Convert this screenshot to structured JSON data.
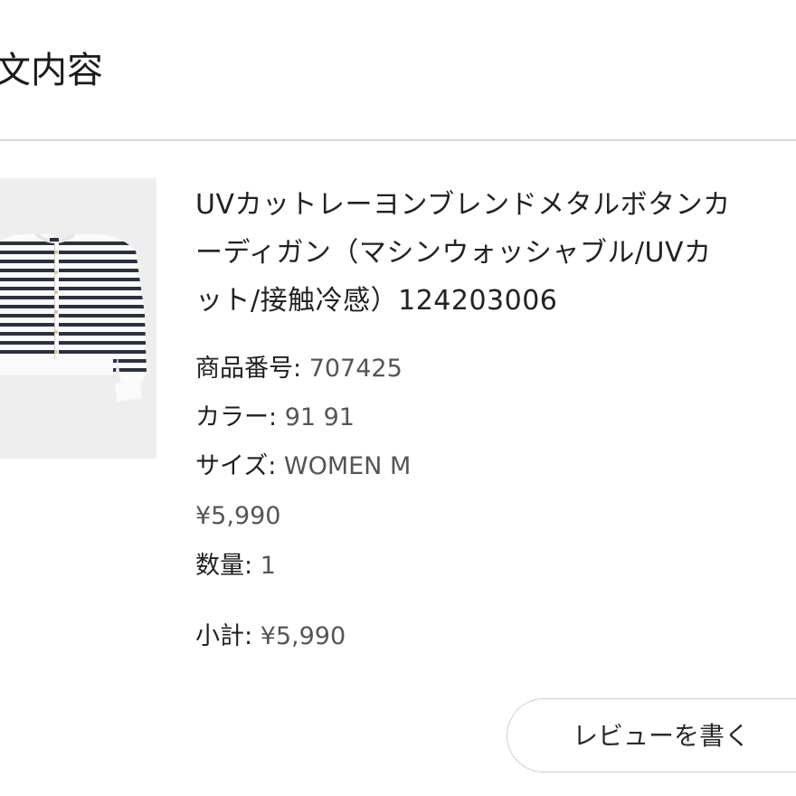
{
  "section": {
    "title": "文内容"
  },
  "product": {
    "name_lines": [
      "UVカットレーヨンブレンドメタルボタンカ",
      "ーディガン（マシンウォッシャブル/UVカ",
      "ット/接触冷感）124203006"
    ],
    "image_icon": "striped-cardigan-image",
    "details": {
      "sku_label": "商品番号:",
      "sku_value": " 707425",
      "color_label": "カラー:",
      "color_value": " 91 91",
      "size_label": "サイズ:",
      "size_value": " WOMEN M",
      "price": "¥5,990",
      "quantity_label": "数量:",
      "quantity_value": " 1",
      "subtotal_label": "小計:",
      "subtotal_value": " ¥5,990"
    }
  },
  "actions": {
    "write_review_label": "レビューを書く"
  },
  "colors": {
    "divider": "#d9d9d9",
    "image_background": "#eeeeee",
    "stripe": "#2b3142",
    "button_border": "#d0d0d0"
  }
}
